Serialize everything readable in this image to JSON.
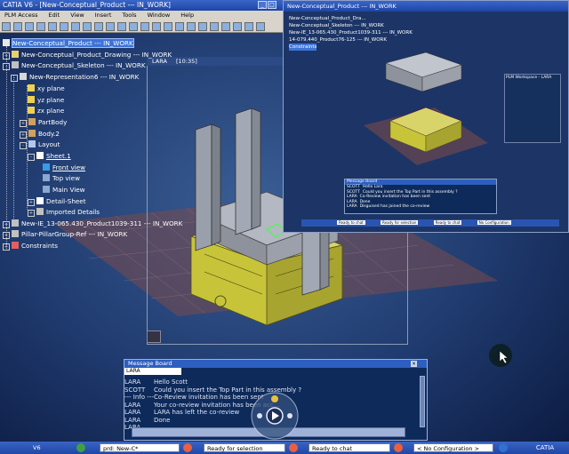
{
  "app": {
    "logo": "CATIA V6",
    "title": "CATIA V6 - [New-Conceptual_Product --- IN_WORK]"
  },
  "menu": [
    "PLM Access",
    "Edit",
    "View",
    "Insert",
    "Tools",
    "Window",
    "Help"
  ],
  "tree": [
    {
      "label": "New-Conceptual_Product --- IN_WORK"
    },
    {
      "label": "New-Conceptual_Product_Drawing --- IN_WORK"
    },
    {
      "label": "New-Conceptual_Skeleton --- IN_WORK"
    },
    {
      "label": "New-Representation6 --- IN_WORK"
    },
    {
      "label": "xy plane"
    },
    {
      "label": "yz plane"
    },
    {
      "label": "zx plane"
    },
    {
      "label": "PartBody"
    },
    {
      "label": "Body.2"
    },
    {
      "label": "Layout"
    },
    {
      "label": "Sheet.1"
    },
    {
      "label": "Front view"
    },
    {
      "label": "Top view"
    },
    {
      "label": "Main View"
    },
    {
      "label": "Detail-Sheet"
    },
    {
      "label": "Imported Details"
    },
    {
      "label": "New-IE_13-065.430_Product1039-311 --- IN_WORK"
    },
    {
      "label": "Pillar-PillarGroup-Ref --- IN_WORK"
    },
    {
      "label": "Constraints"
    }
  ],
  "viewport": {
    "title": "LARA",
    "time": "[10:35]"
  },
  "remote_window": {
    "title": "New-Conceptual_Product --- IN_WORK",
    "tree": [
      "New-Conceptual_Product_Dra...",
      "New-Conceptual_Skeleton --- IN_WORK",
      "New-IE_13-065.430_Product1039-311 --- IN_WORK",
      "14-079.440_Product76-125 --- IN_WORK",
      "Constraints"
    ],
    "mini_panel_title": "PLM Workspace - LARA",
    "mini_board_title": "Message Board",
    "mini_status": [
      "Ready to chat",
      "Ready for selection",
      "Ready to chat",
      "No Configuration"
    ],
    "mini_board_rows": [
      {
        "who": "SCOTT",
        "text": "Hello Lara"
      },
      {
        "who": "SCOTT",
        "text": "Could you insert the Top Part in this assembly ?"
      },
      {
        "who": "LARA",
        "text": "Co-Review invitation has been sent"
      },
      {
        "who": "LARA",
        "text": "Done"
      },
      {
        "who": "LARA",
        "text": "Disguised has joined the co-review"
      }
    ]
  },
  "message_board": {
    "title": "Message Board",
    "user": "LARA",
    "rows": [
      {
        "who": "LARA",
        "text": "Hello Scott"
      },
      {
        "who": "SCOTT",
        "text": "Could you insert the Top Part in this assembly ?"
      },
      {
        "who": "--- Info ---",
        "text": "Co-Review invitation has been sent"
      },
      {
        "who": "LARA",
        "text": "Your co-review invitation has been acc..."
      },
      {
        "who": "LARA",
        "text": "LARA has left the co-review"
      },
      {
        "who": "LARA",
        "text": "Done"
      },
      {
        "who": "LARA",
        "text": ""
      }
    ]
  },
  "taskbar": {
    "app_label": "V6",
    "product_field": "prd: New-C*",
    "selection_status": "Ready for selection",
    "chat_status": "Ready to chat",
    "config_select": "< No Configuration >",
    "logo": "CATIA"
  },
  "colors": {
    "accent": "#3d74d8",
    "background": "#1f3a6e",
    "model_yellow": "#c8c43a",
    "model_gray": "#a7adb8"
  }
}
